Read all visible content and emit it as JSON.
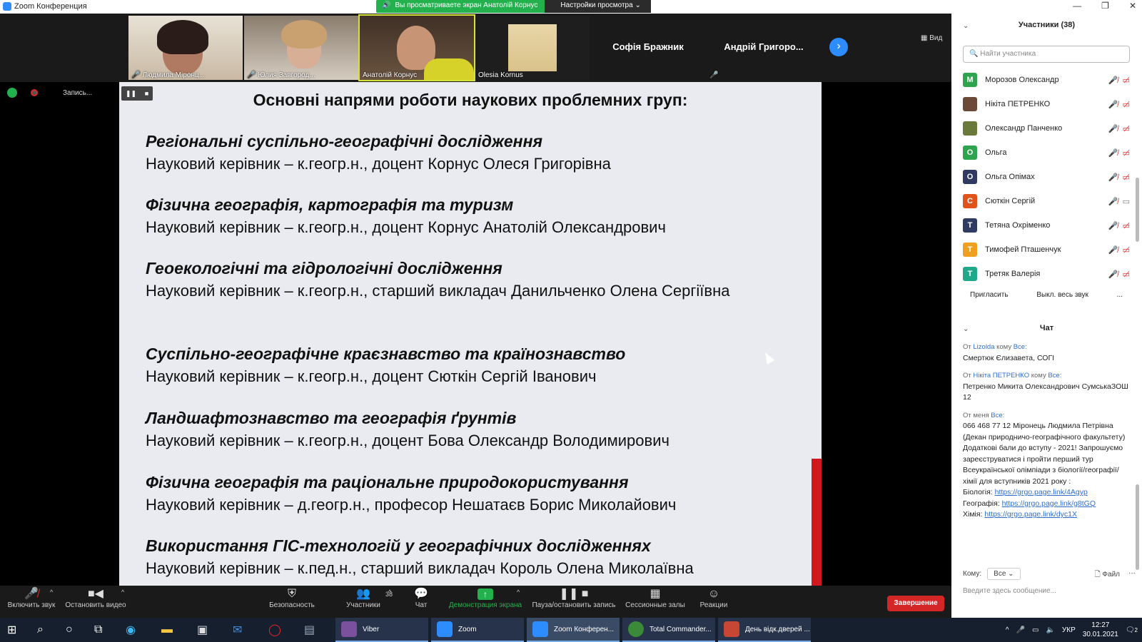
{
  "window": {
    "title": "Zoom Конференция",
    "controls": [
      "—",
      "❐",
      "✕"
    ]
  },
  "banner": {
    "viewing": "Вы просматриваете экран Анатолій Корнус",
    "view_options": "Настройки просмотра ⌄"
  },
  "gallery": {
    "tiles": [
      {
        "name": "Людмила Міронц...",
        "muted": true
      },
      {
        "name": "Юлия Завгород...",
        "muted": true
      },
      {
        "name": "Анатолій Корнус",
        "muted": false
      },
      {
        "name": "Olesia Kornus",
        "muted": false
      },
      {
        "name": "Софія Бражник",
        "muted": false
      },
      {
        "name": "Андрій Григоро...",
        "muted": true
      }
    ],
    "view_label": "Вид"
  },
  "recording": {
    "label": "Запись..."
  },
  "slide": {
    "title": "Основні напрями роботи наукових проблемних груп:",
    "sections": [
      {
        "head": "Регіональні суспільно-географічні дослідження",
        "sup": "Науковий керівник – к.геогр.н., доцент Корнус Олеся Григорівна"
      },
      {
        "head": "Фізична географія, картографія та туризм",
        "sup": "Науковий керівник – к.геогр.н., доцент Корнус Анатолій Олександрович"
      },
      {
        "head": "Геоекологічні та гідрологічні дослідження",
        "sup": "Науковий керівник – к.геогр.н., старший викладач Данильченко Олена Сергіївна"
      },
      {
        "head": "Суспільно-географічне краєзнавство та країнознавство",
        "sup": "Науковий керівник – к.геогр.н., доцент Сюткін Сергій Іванович"
      },
      {
        "head": "Ландшафтознавство та географія ґрунтів",
        "sup": "Науковий керівник – к.геогр.н., доцент Бова Олександр Володимирович"
      },
      {
        "head": "Фізична географія та раціональне природокористування",
        "sup": "Науковий керівник – д.геогр.н., професор Нешатаєв Борис Миколайович"
      },
      {
        "head": "Використання ГІС-технологій у географічних дослідженнях",
        "sup": "Науковий керівник – к.пед.н., старший викладач Король Олена Миколаївна"
      }
    ]
  },
  "participants": {
    "header": "Участники (38)",
    "search_placeholder": "Найти участника",
    "list": [
      {
        "initial": "M",
        "name": "Морозов Олександр",
        "color": "#2ea44f"
      },
      {
        "initial": "",
        "name": "Нікіта ПЕТРЕНКО",
        "color": "#6b4a3a"
      },
      {
        "initial": "",
        "name": "Олександр Панченко",
        "color": "#6a7a3a"
      },
      {
        "initial": "O",
        "name": "Ольга",
        "color": "#2ea44f"
      },
      {
        "initial": "O",
        "name": "Ольга Опімах",
        "color": "#2f3b60"
      },
      {
        "initial": "C",
        "name": "Сюткін Сергій",
        "color": "#e0541c"
      },
      {
        "initial": "T",
        "name": "Тетяна Охріменко",
        "color": "#2f3b60"
      },
      {
        "initial": "T",
        "name": "Тимофей Пташенчук",
        "color": "#f0a020"
      },
      {
        "initial": "T",
        "name": "Третяк Валерія",
        "color": "#1fa88a"
      }
    ],
    "invite": "Пригласить",
    "mute_all": "Выкл. весь звук",
    "more": "..."
  },
  "chat": {
    "title": "Чат",
    "messages": [
      {
        "from": "Lizolda",
        "to": "Все:",
        "text": "Смертюк Єлизавета, СОГІ"
      },
      {
        "from": "Нікіта ПЕТРЕНКО",
        "to": "Все:",
        "text": "Петренко Микита Олександрович СумськаЗОШ 12"
      },
      {
        "from_me": "От меня",
        "to": "Все:",
        "text": "066 468 77 12 Міронець Людмила Петрівна (Декан природничо-географічного факультету) Додаткові бали до вступу - 2021! Запрошуємо зареєструватися і пройти перший тур Всеукраїнської олімпіади з біології/географії/хімії для вступників 2021 року :"
      }
    ],
    "links": [
      {
        "label": "Біологія:",
        "url": "https://grgo.page.link/4Agyp"
      },
      {
        "label": "Географія:",
        "url": "https://grgo.page.link/g8tGQ"
      },
      {
        "label": "Хімія:",
        "url": "https://grgo.page.link/dyc1X"
      }
    ],
    "from_word": "От",
    "to_word": "кому",
    "compose": {
      "to_label": "Кому:",
      "to_value": "Все ⌄",
      "file": "Файл",
      "more": "···",
      "placeholder": "Введите здесь сообщение..."
    }
  },
  "toolbar": {
    "unmute": "Включить звук",
    "stop_video": "Остановить видео",
    "security": "Безопасность",
    "participants": "Участники",
    "participants_count": "38",
    "chat": "Чат",
    "share": "Демонстрация экрана",
    "pause_rec": "Пауза/остановить запись",
    "breakout": "Сессионные залы",
    "reactions": "Реакции",
    "end": "Завершение"
  },
  "taskbar": {
    "apps": [
      {
        "label": "Viber",
        "color": "#7b519d"
      },
      {
        "label": "Zoom",
        "color": "#2d8cff"
      },
      {
        "label": "Zoom Конферен...",
        "color": "#2d8cff"
      },
      {
        "label": "Total Commander...",
        "color": "#3a8a3a"
      },
      {
        "label": "День відк.дверей ...",
        "color": "#c74634"
      }
    ],
    "lang": "УКР",
    "time": "12:27",
    "date": "30.01.2021",
    "notif": "2"
  }
}
